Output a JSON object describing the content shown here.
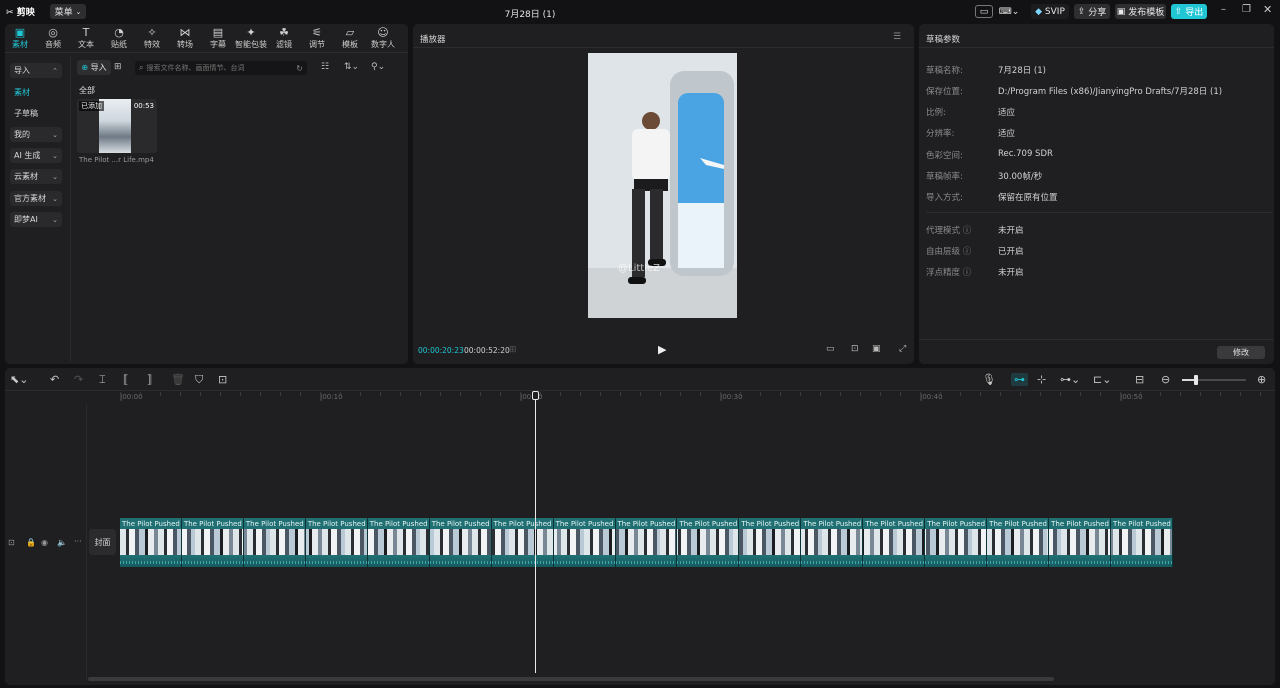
{
  "app": {
    "logo": "剪映",
    "menu": "菜单",
    "title": "7月28日 (1)"
  },
  "titlebar": {
    "svip": "SVIP",
    "share": "分享",
    "publish_template": "发布模板",
    "export": "导出"
  },
  "toolbar": {
    "items": [
      {
        "icon": "media-icon",
        "label": "素材",
        "active": true
      },
      {
        "icon": "audio-icon",
        "label": "音频"
      },
      {
        "icon": "text-icon",
        "label": "文本"
      },
      {
        "icon": "sticker-icon",
        "label": "贴纸"
      },
      {
        "icon": "effects-icon",
        "label": "特效"
      },
      {
        "icon": "transition-icon",
        "label": "转场"
      },
      {
        "icon": "subtitle-icon",
        "label": "字幕"
      },
      {
        "icon": "smart-pack-icon",
        "label": "智能包装"
      },
      {
        "icon": "filter-icon",
        "label": "滤镜"
      },
      {
        "icon": "adjust-icon",
        "label": "调节"
      },
      {
        "icon": "template-icon",
        "label": "模板"
      },
      {
        "icon": "digital-human-icon",
        "label": "数字人"
      }
    ]
  },
  "sidebar": {
    "items": [
      {
        "label": "导入",
        "chev": "⌃"
      },
      {
        "label": "素材"
      },
      {
        "label": "子草稿"
      },
      {
        "label": "我的",
        "chev": "⌄"
      },
      {
        "label": "AI 生成",
        "chev": "⌄"
      },
      {
        "label": "云素材",
        "chev": "⌄"
      },
      {
        "label": "官方素材",
        "chev": "⌄"
      },
      {
        "label": "即梦AI",
        "chev": "⌄"
      }
    ]
  },
  "media": {
    "import_label": "导入",
    "search_placeholder": "搜索文件名称、画面情节、台词",
    "section": "全部",
    "files": [
      {
        "badge": "已添加",
        "duration": "00:53",
        "name": "The Pilot ...r Life.mp4"
      }
    ]
  },
  "player": {
    "title": "播放器",
    "current_time": "00:00:20:23",
    "total_time": "00:00:52:20",
    "watermark": "@LittleZ"
  },
  "draft_params": {
    "title": "草稿参数",
    "rows": [
      {
        "label": "草稿名称:",
        "value": "7月28日 (1)"
      },
      {
        "label": "保存位置:",
        "value": "D:/Program Files (x86)/JianyingPro Drafts/7月28日 (1)"
      },
      {
        "label": "比例:",
        "value": "适应"
      },
      {
        "label": "分辨率:",
        "value": "适应"
      },
      {
        "label": "色彩空间:",
        "value": "Rec.709 SDR"
      },
      {
        "label": "草稿帧率:",
        "value": "30.00帧/秒"
      },
      {
        "label": "导入方式:",
        "value": "保留在原有位置"
      }
    ],
    "rows2": [
      {
        "label": "代理模式",
        "value": "未开启"
      },
      {
        "label": "自由层级",
        "value": "已开启"
      },
      {
        "label": "浮点精度",
        "value": "未开启"
      }
    ],
    "modify": "修改"
  },
  "timeline": {
    "ruler": [
      "|00:00",
      "|00:10",
      "|00:20",
      "|00:30",
      "|00:40",
      "|00:50"
    ],
    "cover_label": "封面",
    "clip_label": "The Pilot Pushed Him Out of the Plane",
    "clip_count": 17,
    "playhead_fraction": 0.394
  },
  "colors": {
    "accent": "#21c6d4",
    "panel": "#1f1f21",
    "bg": "#121214",
    "clip": "#1f6f73"
  }
}
